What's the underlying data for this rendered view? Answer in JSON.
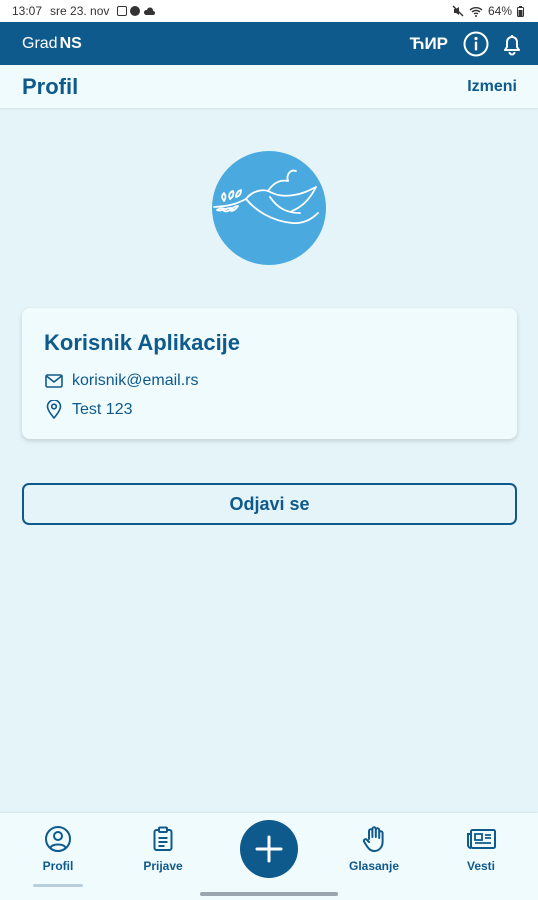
{
  "status_bar": {
    "time": "13:07",
    "date": "sre 23. nov",
    "battery": "64%"
  },
  "app_bar": {
    "brand_light": "Grad",
    "brand_bold": "NS",
    "script_toggle": "ЋИР",
    "icons": [
      "info-icon",
      "bell-icon"
    ]
  },
  "header": {
    "title": "Profil",
    "edit_label": "Izmeni"
  },
  "profile": {
    "avatar_color": "#4aa9df",
    "name": "Korisnik Aplikacije",
    "email": "korisnik@email.rs",
    "address": "Test 123"
  },
  "logout_label": "Odjavi se",
  "bottom_nav": {
    "items": [
      {
        "label": "Profil",
        "icon": "profile-icon",
        "active": true
      },
      {
        "label": "Prijave",
        "icon": "clipboard-icon",
        "active": false
      },
      {
        "label": "Glasanje",
        "icon": "hand-icon",
        "active": false
      },
      {
        "label": "Vesti",
        "icon": "newspaper-icon",
        "active": false
      }
    ],
    "fab_icon": "plus-icon"
  },
  "colors": {
    "primary": "#0f5a8c",
    "background": "#e4f4f9",
    "surface": "#f0fbfe"
  }
}
